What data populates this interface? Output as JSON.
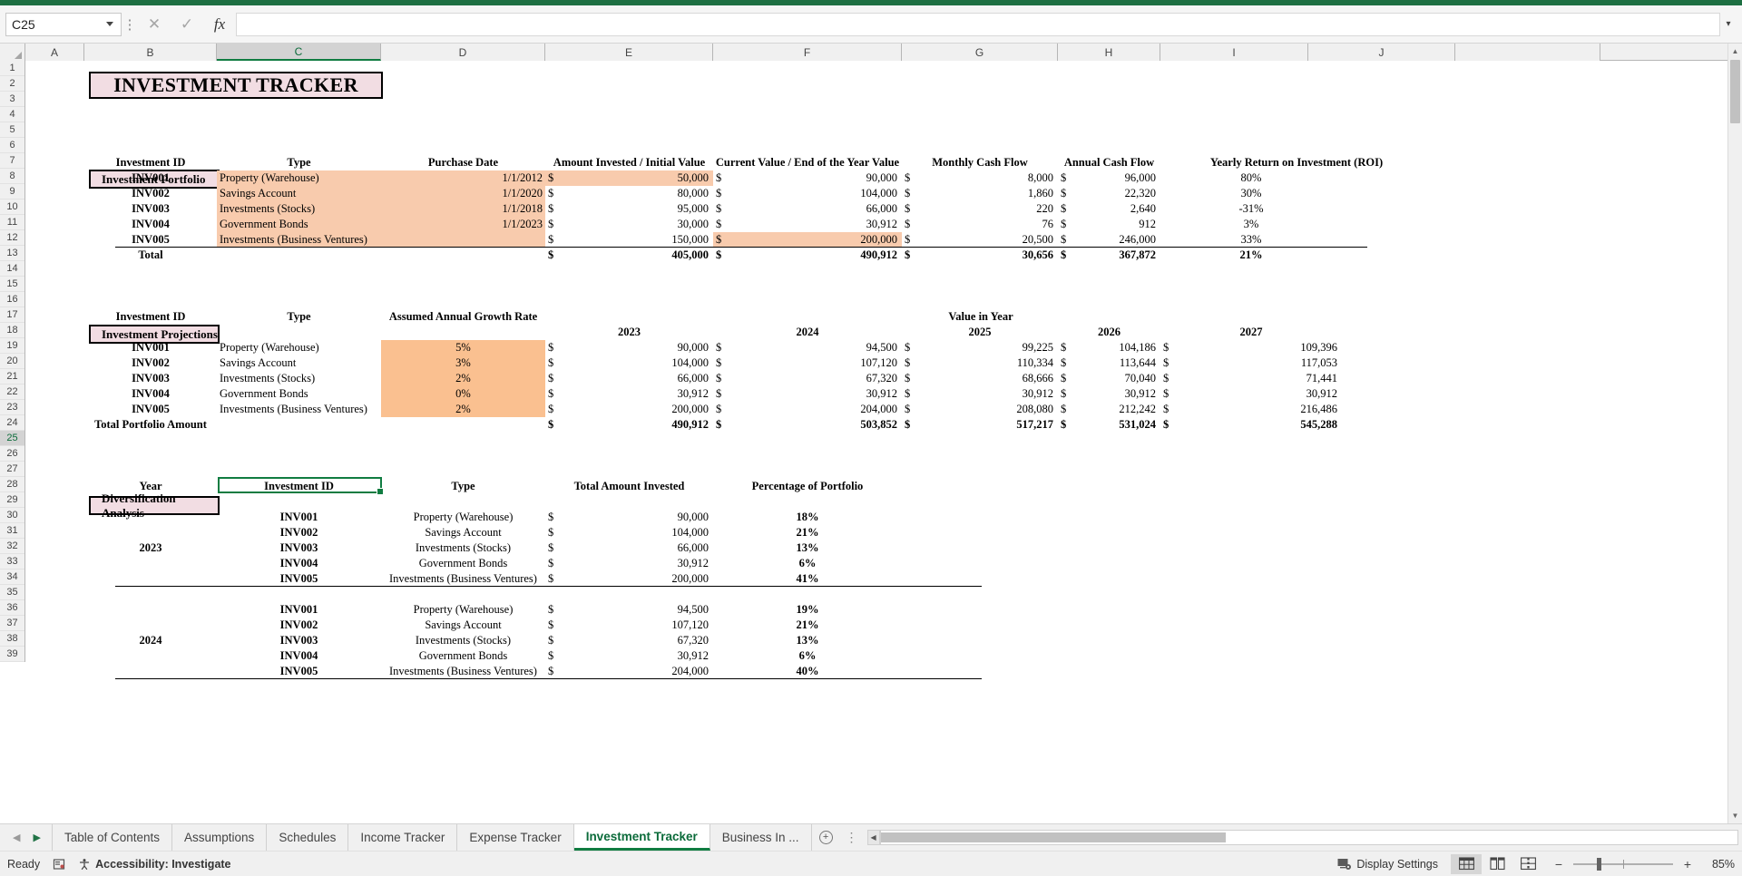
{
  "formula_bar": {
    "name_box_value": "C25",
    "formula_value": "",
    "cancel_icon": "close-icon",
    "confirm_icon": "check-icon",
    "function_icon": "fx-icon",
    "expand_icon": "chevron-down-icon"
  },
  "columns": [
    "A",
    "B",
    "C",
    "D",
    "E",
    "F",
    "G",
    "H",
    "I",
    "J"
  ],
  "selected_column": "C",
  "rows": [
    1,
    2,
    3,
    4,
    5,
    6,
    7,
    8,
    9,
    10,
    11,
    12,
    13,
    14,
    15,
    16,
    17,
    18,
    19,
    20,
    21,
    22,
    23,
    24,
    25,
    26,
    27,
    28,
    29,
    30,
    31,
    32,
    33,
    34,
    35,
    36,
    37,
    38,
    39
  ],
  "selected_row": 25,
  "sheet": {
    "title": "INVESTMENT TRACKER",
    "sections": {
      "portfolio_label": "Investment Portfolio",
      "projections_label": "Investment Projections",
      "diversification_label": "Diversification Analysis"
    },
    "portfolio": {
      "headers": [
        "Investment ID",
        "Type",
        "Purchase Date",
        "Amount Invested / Initial Value",
        "Current Value / End of the Year Value",
        "Monthly Cash Flow",
        "Annual Cash Flow",
        "Yearly Return on Investment (ROI)"
      ],
      "rows": [
        {
          "id": "INV001",
          "type": "Property (Warehouse)",
          "date": "1/1/2012",
          "invested": "50,000",
          "current": "90,000",
          "monthly": "8,000",
          "annual": "96,000",
          "roi": "80%"
        },
        {
          "id": "INV002",
          "type": "Savings Account",
          "date": "1/1/2020",
          "invested": "80,000",
          "current": "104,000",
          "monthly": "1,860",
          "annual": "22,320",
          "roi": "30%"
        },
        {
          "id": "INV003",
          "type": "Investments (Stocks)",
          "date": "1/1/2018",
          "invested": "95,000",
          "current": "66,000",
          "monthly": "220",
          "annual": "2,640",
          "roi": "-31%"
        },
        {
          "id": "INV004",
          "type": "Government Bonds",
          "date": "1/1/2023",
          "invested": "30,000",
          "current": "30,912",
          "monthly": "76",
          "annual": "912",
          "roi": "3%"
        },
        {
          "id": "INV005",
          "type": "Investments (Business Ventures)",
          "date": "",
          "invested": "150,000",
          "current": "200,000",
          "monthly": "20,500",
          "annual": "246,000",
          "roi": "33%"
        }
      ],
      "total": {
        "label": "Total",
        "invested": "405,000",
        "current": "490,912",
        "monthly": "30,656",
        "annual": "367,872",
        "roi": "21%"
      },
      "currency_symbol": "$"
    },
    "projections": {
      "headers": [
        "Investment ID",
        "Type",
        "Assumed Annual Growth Rate",
        "Value in Year"
      ],
      "years": [
        "2023",
        "2024",
        "2025",
        "2026",
        "2027"
      ],
      "rows": [
        {
          "id": "INV001",
          "type": "Property (Warehouse)",
          "rate": "5%",
          "values": [
            "90,000",
            "94,500",
            "99,225",
            "104,186",
            "109,396"
          ]
        },
        {
          "id": "INV002",
          "type": "Savings Account",
          "rate": "3%",
          "values": [
            "104,000",
            "107,120",
            "110,334",
            "113,644",
            "117,053"
          ]
        },
        {
          "id": "INV003",
          "type": "Investments (Stocks)",
          "rate": "2%",
          "values": [
            "66,000",
            "67,320",
            "68,666",
            "70,040",
            "71,441"
          ]
        },
        {
          "id": "INV004",
          "type": "Government Bonds",
          "rate": "0%",
          "values": [
            "30,912",
            "30,912",
            "30,912",
            "30,912",
            "30,912"
          ]
        },
        {
          "id": "INV005",
          "type": "Investments (Business Ventures)",
          "rate": "2%",
          "values": [
            "200,000",
            "204,000",
            "208,080",
            "212,242",
            "216,486"
          ]
        }
      ],
      "total": {
        "label": "Total Portfolio Amount",
        "values": [
          "490,912",
          "503,852",
          "517,217",
          "531,024",
          "545,288"
        ]
      },
      "currency_symbol": "$"
    },
    "diversification": {
      "headers": [
        "Year",
        "Investment ID",
        "Type",
        "Total Amount Invested",
        "Percentage of Portfolio"
      ],
      "groups": [
        {
          "year": "2023",
          "rows": [
            {
              "id": "INV001",
              "type": "Property (Warehouse)",
              "amount": "90,000",
              "pct": "18%"
            },
            {
              "id": "INV002",
              "type": "Savings Account",
              "amount": "104,000",
              "pct": "21%"
            },
            {
              "id": "INV003",
              "type": "Investments (Stocks)",
              "amount": "66,000",
              "pct": "13%"
            },
            {
              "id": "INV004",
              "type": "Government Bonds",
              "amount": "30,912",
              "pct": "6%"
            },
            {
              "id": "INV005",
              "type": "Investments (Business Ventures)",
              "amount": "200,000",
              "pct": "41%"
            }
          ]
        },
        {
          "year": "2024",
          "rows": [
            {
              "id": "INV001",
              "type": "Property (Warehouse)",
              "amount": "94,500",
              "pct": "19%"
            },
            {
              "id": "INV002",
              "type": "Savings Account",
              "amount": "107,120",
              "pct": "21%"
            },
            {
              "id": "INV003",
              "type": "Investments (Stocks)",
              "amount": "67,320",
              "pct": "13%"
            },
            {
              "id": "INV004",
              "type": "Government Bonds",
              "amount": "30,912",
              "pct": "6%"
            },
            {
              "id": "INV005",
              "type": "Investments (Business Ventures)",
              "amount": "204,000",
              "pct": "40%"
            }
          ]
        }
      ],
      "currency_symbol": "$"
    }
  },
  "tabs": {
    "items": [
      {
        "label": "Table of Contents",
        "active": false
      },
      {
        "label": "Assumptions",
        "active": false
      },
      {
        "label": "Schedules",
        "active": false
      },
      {
        "label": "Income Tracker",
        "active": false
      },
      {
        "label": "Expense Tracker",
        "active": false
      },
      {
        "label": "Investment Tracker",
        "active": true
      },
      {
        "label": "Business In ...",
        "active": false
      }
    ],
    "add_sheet_icon": "plus-circle-icon",
    "prev_icon": "triangle-left-icon",
    "next_icon": "triangle-right-icon",
    "more_icon": "vertical-dots-icon"
  },
  "status": {
    "ready_text": "Ready",
    "macro_icon": "record-macro-icon",
    "accessibility_text": "Accessibility: Investigate",
    "accessibility_icon": "accessibility-icon",
    "display_settings_text": "Display Settings",
    "display_settings_icon": "display-settings-icon",
    "view_normal_icon": "normal-view-icon",
    "view_pagelayout_icon": "page-layout-icon",
    "view_pagebreak_icon": "page-break-icon",
    "zoom_out_icon": "minus-icon",
    "zoom_in_icon": "plus-icon",
    "zoom_level": "85%"
  },
  "theme": {
    "excel_green": "#107c41",
    "banner_pink": "#f2dde3",
    "fill_peach": "#f8cbad",
    "fill_orange": "#fac090",
    "selection_green": "#107c41"
  }
}
